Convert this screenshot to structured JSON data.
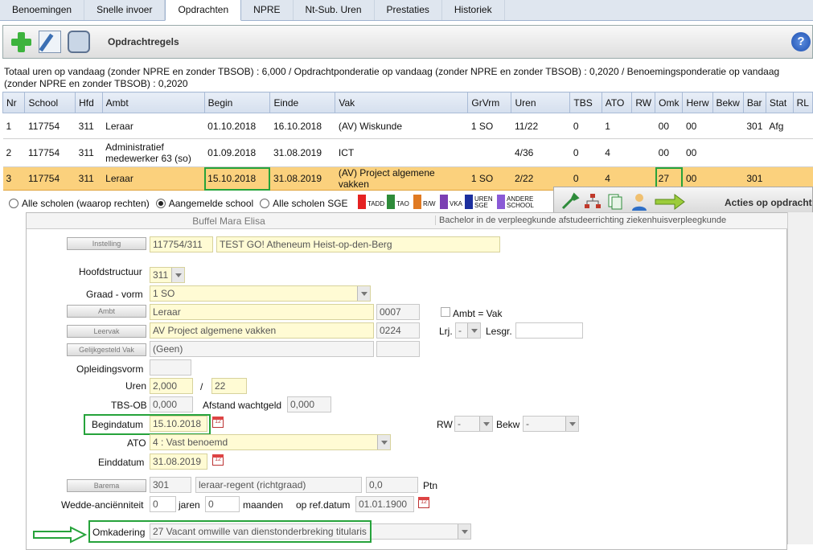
{
  "tabs": [
    "Benoemingen",
    "Snelle invoer",
    "Opdrachten",
    "NPRE",
    "Nt-Sub. Uren",
    "Prestaties",
    "Historiek"
  ],
  "active_tab": "Opdrachten",
  "toolbar": {
    "title": "Opdrachtregels",
    "add_icon": "plus-icon",
    "edit_icon": "edit-icon",
    "delete_icon": "delete-icon",
    "help": "?"
  },
  "totals": "Totaal uren op vandaag (zonder NPRE en zonder TBSOB) : 6,000 / Opdrachtponderatie op vandaag (zonder NPRE en zonder TBSOB) : 0,2020 / Benoemingsponderatie op vandaag (zonder NPRE en zonder TBSOB) : 0,2020",
  "table": {
    "headers": [
      "Nr",
      "School",
      "Hfd",
      "Ambt",
      "Begin",
      "Einde",
      "Vak",
      "GrVrm",
      "Uren",
      "TBS",
      "ATO",
      "RW",
      "Omk",
      "Herw",
      "Bekw",
      "Bar",
      "Stat",
      "RL"
    ],
    "rows": [
      [
        "1",
        "117754",
        "311",
        "Leraar",
        "01.10.2018",
        "16.10.2018",
        "(AV) Wiskunde",
        "1 SO",
        "11/22",
        "0",
        "1",
        "",
        "00",
        "00",
        "",
        "301",
        "Afg",
        ""
      ],
      [
        "2",
        "117754",
        "311",
        "Administratief medewerker 63 (so)",
        "01.09.2018",
        "31.08.2019",
        "ICT",
        "",
        "4/36",
        "0",
        "4",
        "",
        "00",
        "00",
        "",
        "",
        "",
        ""
      ],
      [
        "3",
        "117754",
        "311",
        "Leraar",
        "15.10.2018",
        "31.08.2019",
        "(AV) Project algemene vakken",
        "1 SO",
        "2/22",
        "0",
        "4",
        "",
        "27",
        "00",
        "",
        "301",
        "",
        ""
      ]
    ]
  },
  "radios": {
    "all_schools": "Alle scholen (waarop rechten)",
    "logged_school": "Aangemelde school",
    "sge": "Alle scholen SGE",
    "selected": "logged_school"
  },
  "legend": [
    {
      "label": "TADD",
      "color": "#e52222"
    },
    {
      "label": "TAO",
      "color": "#2e8b3a"
    },
    {
      "label": "R/W",
      "color": "#e07a22"
    },
    {
      "label": "VKA",
      "color": "#7b3fb3"
    },
    {
      "label": "UREN SGE",
      "color": "#1c2f9e"
    },
    {
      "label": "ANDERE SCHOOL",
      "color": "#8a5ad6"
    }
  ],
  "actions": {
    "label": "Acties op opdracht"
  },
  "form": {
    "person": "Buffel Mara Elisa",
    "degree": "Bachelor in de verpleegkunde afstudeerrichting ziekenhuisverpleegkunde",
    "instelling_btn": "Instelling",
    "instelling_code": "117754/311",
    "instelling_name": "TEST GO! Atheneum Heist-op-den-Berg",
    "hoofdstructuur_label": "Hoofdstructuur",
    "hoofdstructuur": "311",
    "graad_label": "Graad - vorm",
    "graad": "1 SO",
    "ambt_btn": "Ambt",
    "ambt": "Leraar",
    "ambt_code": "0007",
    "ambt_vak_label": "Ambt = Vak",
    "leervak_btn": "Leervak",
    "leervak": "AV Project algemene vakken",
    "leervak_code": "0224",
    "lrj_label": "Lrj.",
    "lrj": "-",
    "lesgr_label": "Lesgr.",
    "gelijk_btn": "Gelijkgesteld Vak",
    "gelijk": "(Geen)",
    "opleidingsvorm_label": "Opleidingsvorm",
    "uren_label": "Uren",
    "uren": "2,000",
    "uren_sep": "/",
    "uren_total": "22",
    "tbs_label": "TBS-OB",
    "tbs": "0,000",
    "afstand_label": "Afstand wachtgeld",
    "afstand": "0,000",
    "begindatum_label": "Begindatum",
    "begindatum": "15.10.2018",
    "rw_label": "RW",
    "rw": "-",
    "bekw_label": "Bekw",
    "bekw": "-",
    "ato_label": "ATO",
    "ato": "4 : Vast benoemd",
    "einddatum_label": "Einddatum",
    "einddatum": "31.08.2019",
    "barema_btn": "Barema",
    "barema": "301",
    "barema_name": "leraar-regent (richtgraad)",
    "barema_ptn": "0,0",
    "ptn_label": "Ptn",
    "wedde_label": "Wedde-anciënniteit",
    "jaren": "0",
    "jaren_label": "jaren",
    "maanden": "0",
    "maanden_label": "maanden",
    "refdatum_label": "op ref.datum",
    "refdatum": "01.01.1900",
    "omkadering_label": "Omkadering",
    "omkadering": "27 Vacant omwille van dienstonderbreking titularis"
  },
  "annotation_color": "#26a33b"
}
